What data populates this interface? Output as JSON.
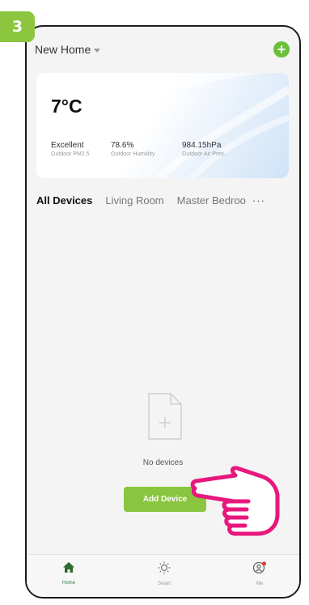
{
  "step_badge": "3",
  "header": {
    "home_name": "New Home",
    "add_icon": "plus-circle-icon"
  },
  "weather": {
    "temperature": "7°C",
    "stats": [
      {
        "value": "Excellent",
        "label": "Outdoor PM2.5"
      },
      {
        "value": "78.6%",
        "label": "Outdoor Humidity"
      },
      {
        "value": "984.15hPa",
        "label": "Outdoor Air Pres..."
      }
    ]
  },
  "rooms": {
    "tabs": [
      "All Devices",
      "Living Room",
      "Master Bedroo"
    ],
    "more": "···"
  },
  "empty_state": {
    "message": "No devices",
    "add_button": "Add Device"
  },
  "nav": {
    "items": [
      {
        "label": "Home",
        "icon": "home-icon"
      },
      {
        "label": "Smart",
        "icon": "sun-icon"
      },
      {
        "label": "Me",
        "icon": "user-icon"
      }
    ]
  },
  "colors": {
    "accent": "#8cc63f",
    "nav_active": "#2e7d32",
    "pointer": "#e8177d"
  }
}
